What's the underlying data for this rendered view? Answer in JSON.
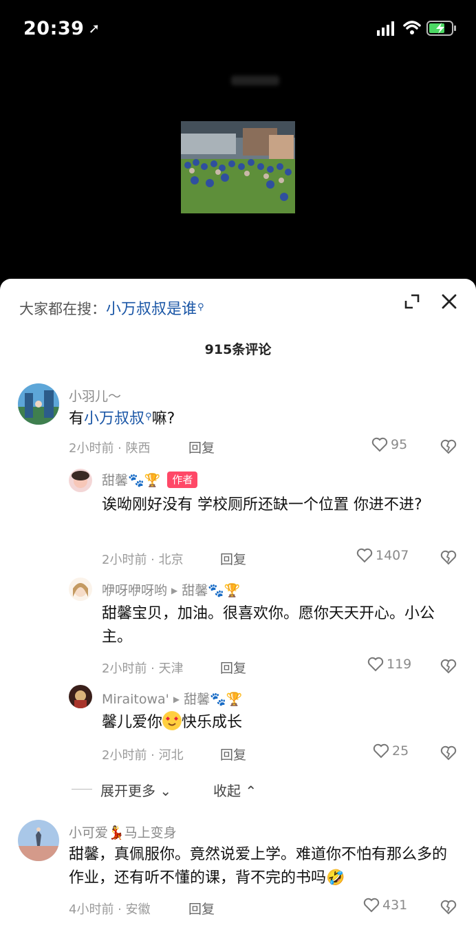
{
  "status": {
    "time": "20:39"
  },
  "sheet": {
    "search_prefix": "大家都在搜：",
    "search_term": "小万叔叔是谁",
    "comment_count": "915条评论"
  },
  "comments": [
    {
      "name": "小羽儿～",
      "text_prefix": "有",
      "text_link": "小万叔叔",
      "text_suffix": "嘛?",
      "meta": "2小时前 · 陕西",
      "reply": "回复",
      "likes": "95"
    },
    {
      "name": "甜馨🐾🏆",
      "badge": "作者",
      "text": "诶呦刚好没有 学校厕所还缺一个位置 你进不进?",
      "meta": "2小时前 · 北京",
      "reply": "回复",
      "likes": "1407"
    },
    {
      "name": "咿呀咿呀哟",
      "to": "甜馨🐾🏆",
      "text": "甜馨宝贝，加油。很喜欢你。愿你天天开心。小公主。",
      "meta": "2小时前 · 天津",
      "reply": "回复",
      "likes": "119"
    },
    {
      "name": "Miraitowa'",
      "to": "甜馨🐾🏆",
      "text_prefix": "馨儿爱你",
      "text_suffix": "快乐成长",
      "meta": "2小时前 · 河北",
      "reply": "回复",
      "likes": "25"
    },
    {
      "name": "小可爱💃马上变身",
      "text": "甜馨，真佩服你。竟然说爱上学。难道你不怕有那么多的作业，还有听不懂的课，背不完的书吗🤣",
      "meta": "4小时前 · 安徽",
      "reply": "回复",
      "likes": "431"
    }
  ],
  "thread_controls": {
    "expand": "展开更多",
    "collapse": "收起"
  }
}
